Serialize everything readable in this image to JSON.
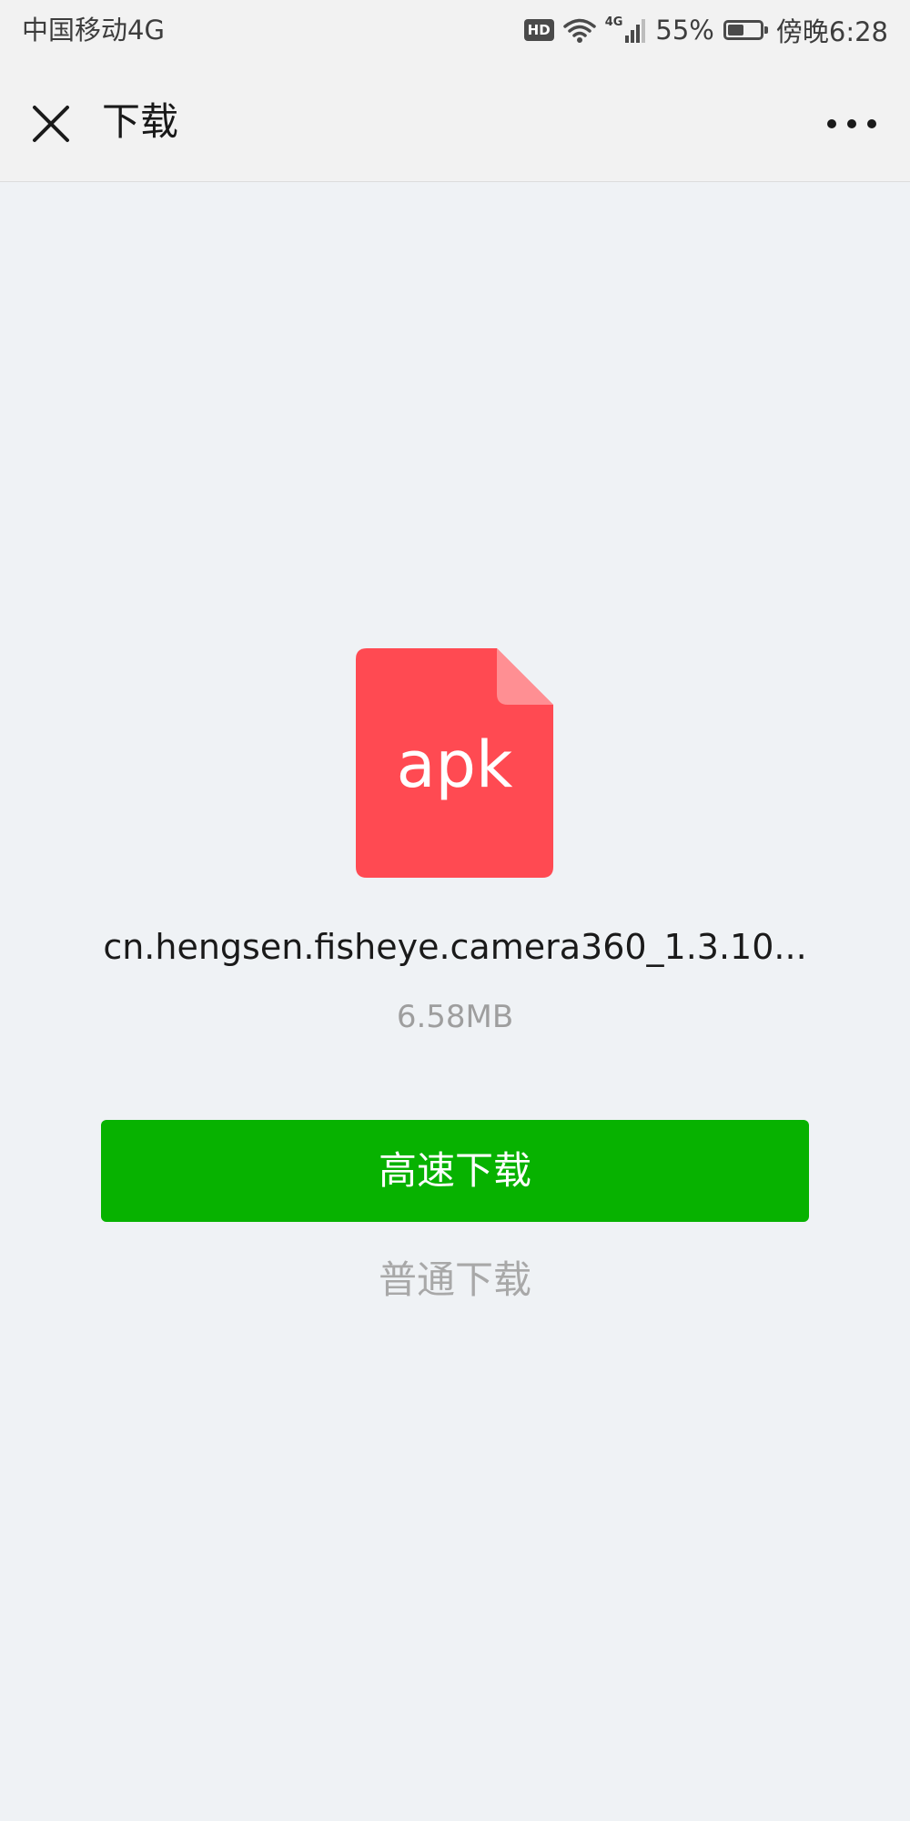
{
  "status_bar": {
    "carrier": "中国移动4G",
    "hd_badge": "HD",
    "network_type": "4G",
    "battery_percent": "55%",
    "battery_level": 0.55,
    "time": "傍晚6:28"
  },
  "nav": {
    "title": "下载",
    "close_icon": "close-icon",
    "more_icon": "more-horizontal-icon"
  },
  "file": {
    "icon_name": "apk-file-icon",
    "icon_color": "#ff4a52",
    "icon_fold_color": "#ff8f93",
    "extension": "apk",
    "name": "cn.hengsen.fisheye.camera360_1.3.10...",
    "size": "6.58MB"
  },
  "actions": {
    "primary_label": "高速下载",
    "primary_color": "#07b200",
    "secondary_label": "普通下载"
  }
}
